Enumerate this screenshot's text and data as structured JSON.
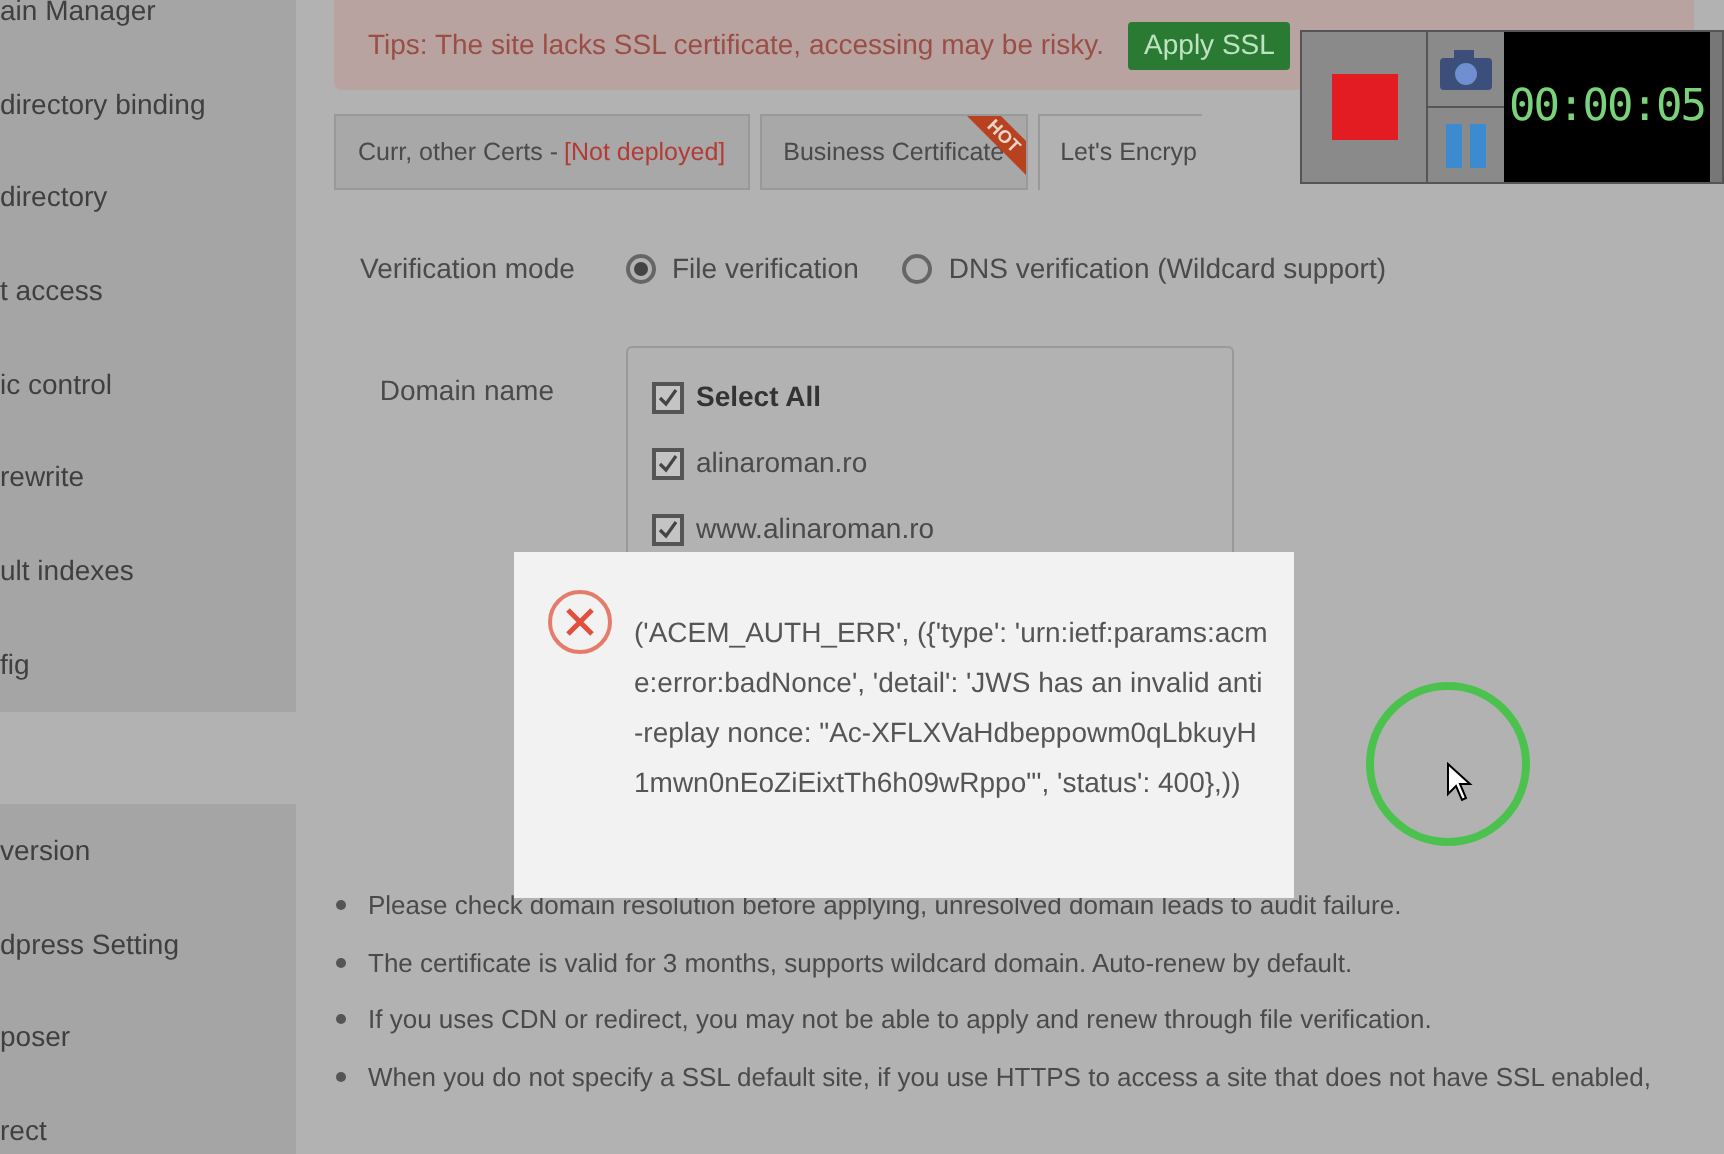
{
  "sidebar": {
    "items": [
      {
        "label": "ain Manager",
        "selected": false
      },
      {
        "label": "directory binding",
        "selected": false
      },
      {
        "label": "directory",
        "selected": false
      },
      {
        "label": "t access",
        "selected": false
      },
      {
        "label": "ic control",
        "selected": false
      },
      {
        "label": "rewrite",
        "selected": false
      },
      {
        "label": "ult indexes",
        "selected": false
      },
      {
        "label": "fig",
        "selected": false
      },
      {
        "selected": true
      },
      {
        "label": "version",
        "selected": false
      },
      {
        "label": "dpress Setting",
        "selected": false
      },
      {
        "label": "poser",
        "selected": false
      },
      {
        "label": "rect",
        "selected": false
      }
    ]
  },
  "tips": {
    "text": "Tips: The site lacks SSL certificate, accessing may be risky.",
    "button": "Apply SSL"
  },
  "tabs": [
    {
      "label": "Curr, other Certs - ",
      "status": "[Not deployed]",
      "selected": false
    },
    {
      "label": "Business Certificate",
      "badge": "HOT",
      "selected": false
    },
    {
      "label": "Let's Encryp",
      "selected": true
    }
  ],
  "recorder": {
    "timer": "00:00:05"
  },
  "verification": {
    "label": "Verification mode",
    "options": [
      {
        "label": "File verification",
        "selected": true
      },
      {
        "label": "DNS verification (Wildcard support)",
        "selected": false
      }
    ]
  },
  "domains": {
    "label": "Domain name",
    "items": [
      {
        "label": "Select All",
        "checked": true,
        "kind": "all"
      },
      {
        "label": "alinaroman.ro",
        "checked": true,
        "kind": "domain"
      },
      {
        "label": "www.alinaroman.ro",
        "checked": true,
        "kind": "domain"
      }
    ]
  },
  "error_toast": {
    "message": "('ACEM_AUTH_ERR', ({'type': 'urn:ietf:params:acme:error:badNonce', 'detail': 'JWS has an invalid anti-replay nonce: \"Ac-XFLXVaHdbeppowm0qLbkuyH1mwn0nEoZiEixtTh6h09wRppo\"', 'status': 400},))"
  },
  "notes": [
    "Please check domain resolution before applying, unresolved domain leads to audit failure.",
    "The certificate is valid for 3 months, supports wildcard domain. Auto-renew by default.",
    "If you uses CDN or redirect, you may not be able to apply and renew through file verification.",
    "When you do not specify a SSL default site, if you use HTTPS to access a site that does not have SSL enabled,"
  ]
}
